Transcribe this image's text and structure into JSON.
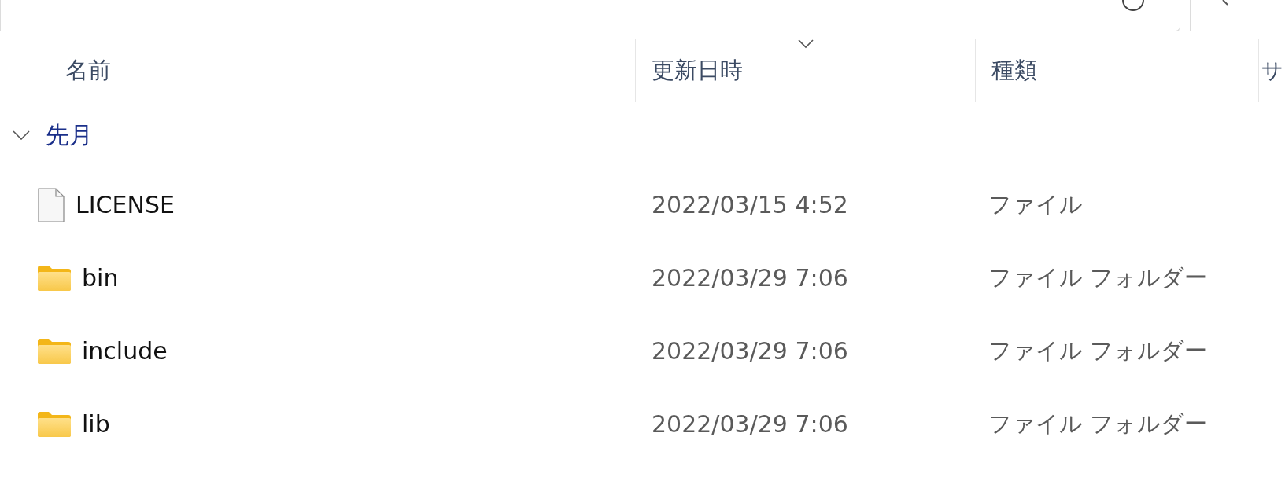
{
  "columns": [
    {
      "label": "名前",
      "sorted": false
    },
    {
      "label": "更新日時",
      "sorted": true
    },
    {
      "label": "種類",
      "sorted": false
    },
    {
      "label": "サ",
      "sorted": false
    }
  ],
  "groups": [
    {
      "label": "先月",
      "expanded": true,
      "items": [
        {
          "kind": "file",
          "name": "LICENSE",
          "modified": "2022/03/15 4:52",
          "type": "ファイル"
        },
        {
          "kind": "folder",
          "name": "bin",
          "modified": "2022/03/29 7:06",
          "type": "ファイル フォルダー"
        },
        {
          "kind": "folder",
          "name": "include",
          "modified": "2022/03/29 7:06",
          "type": "ファイル フォルダー"
        },
        {
          "kind": "folder",
          "name": "lib",
          "modified": "2022/03/29 7:06",
          "type": "ファイル フォルダー"
        }
      ]
    }
  ]
}
